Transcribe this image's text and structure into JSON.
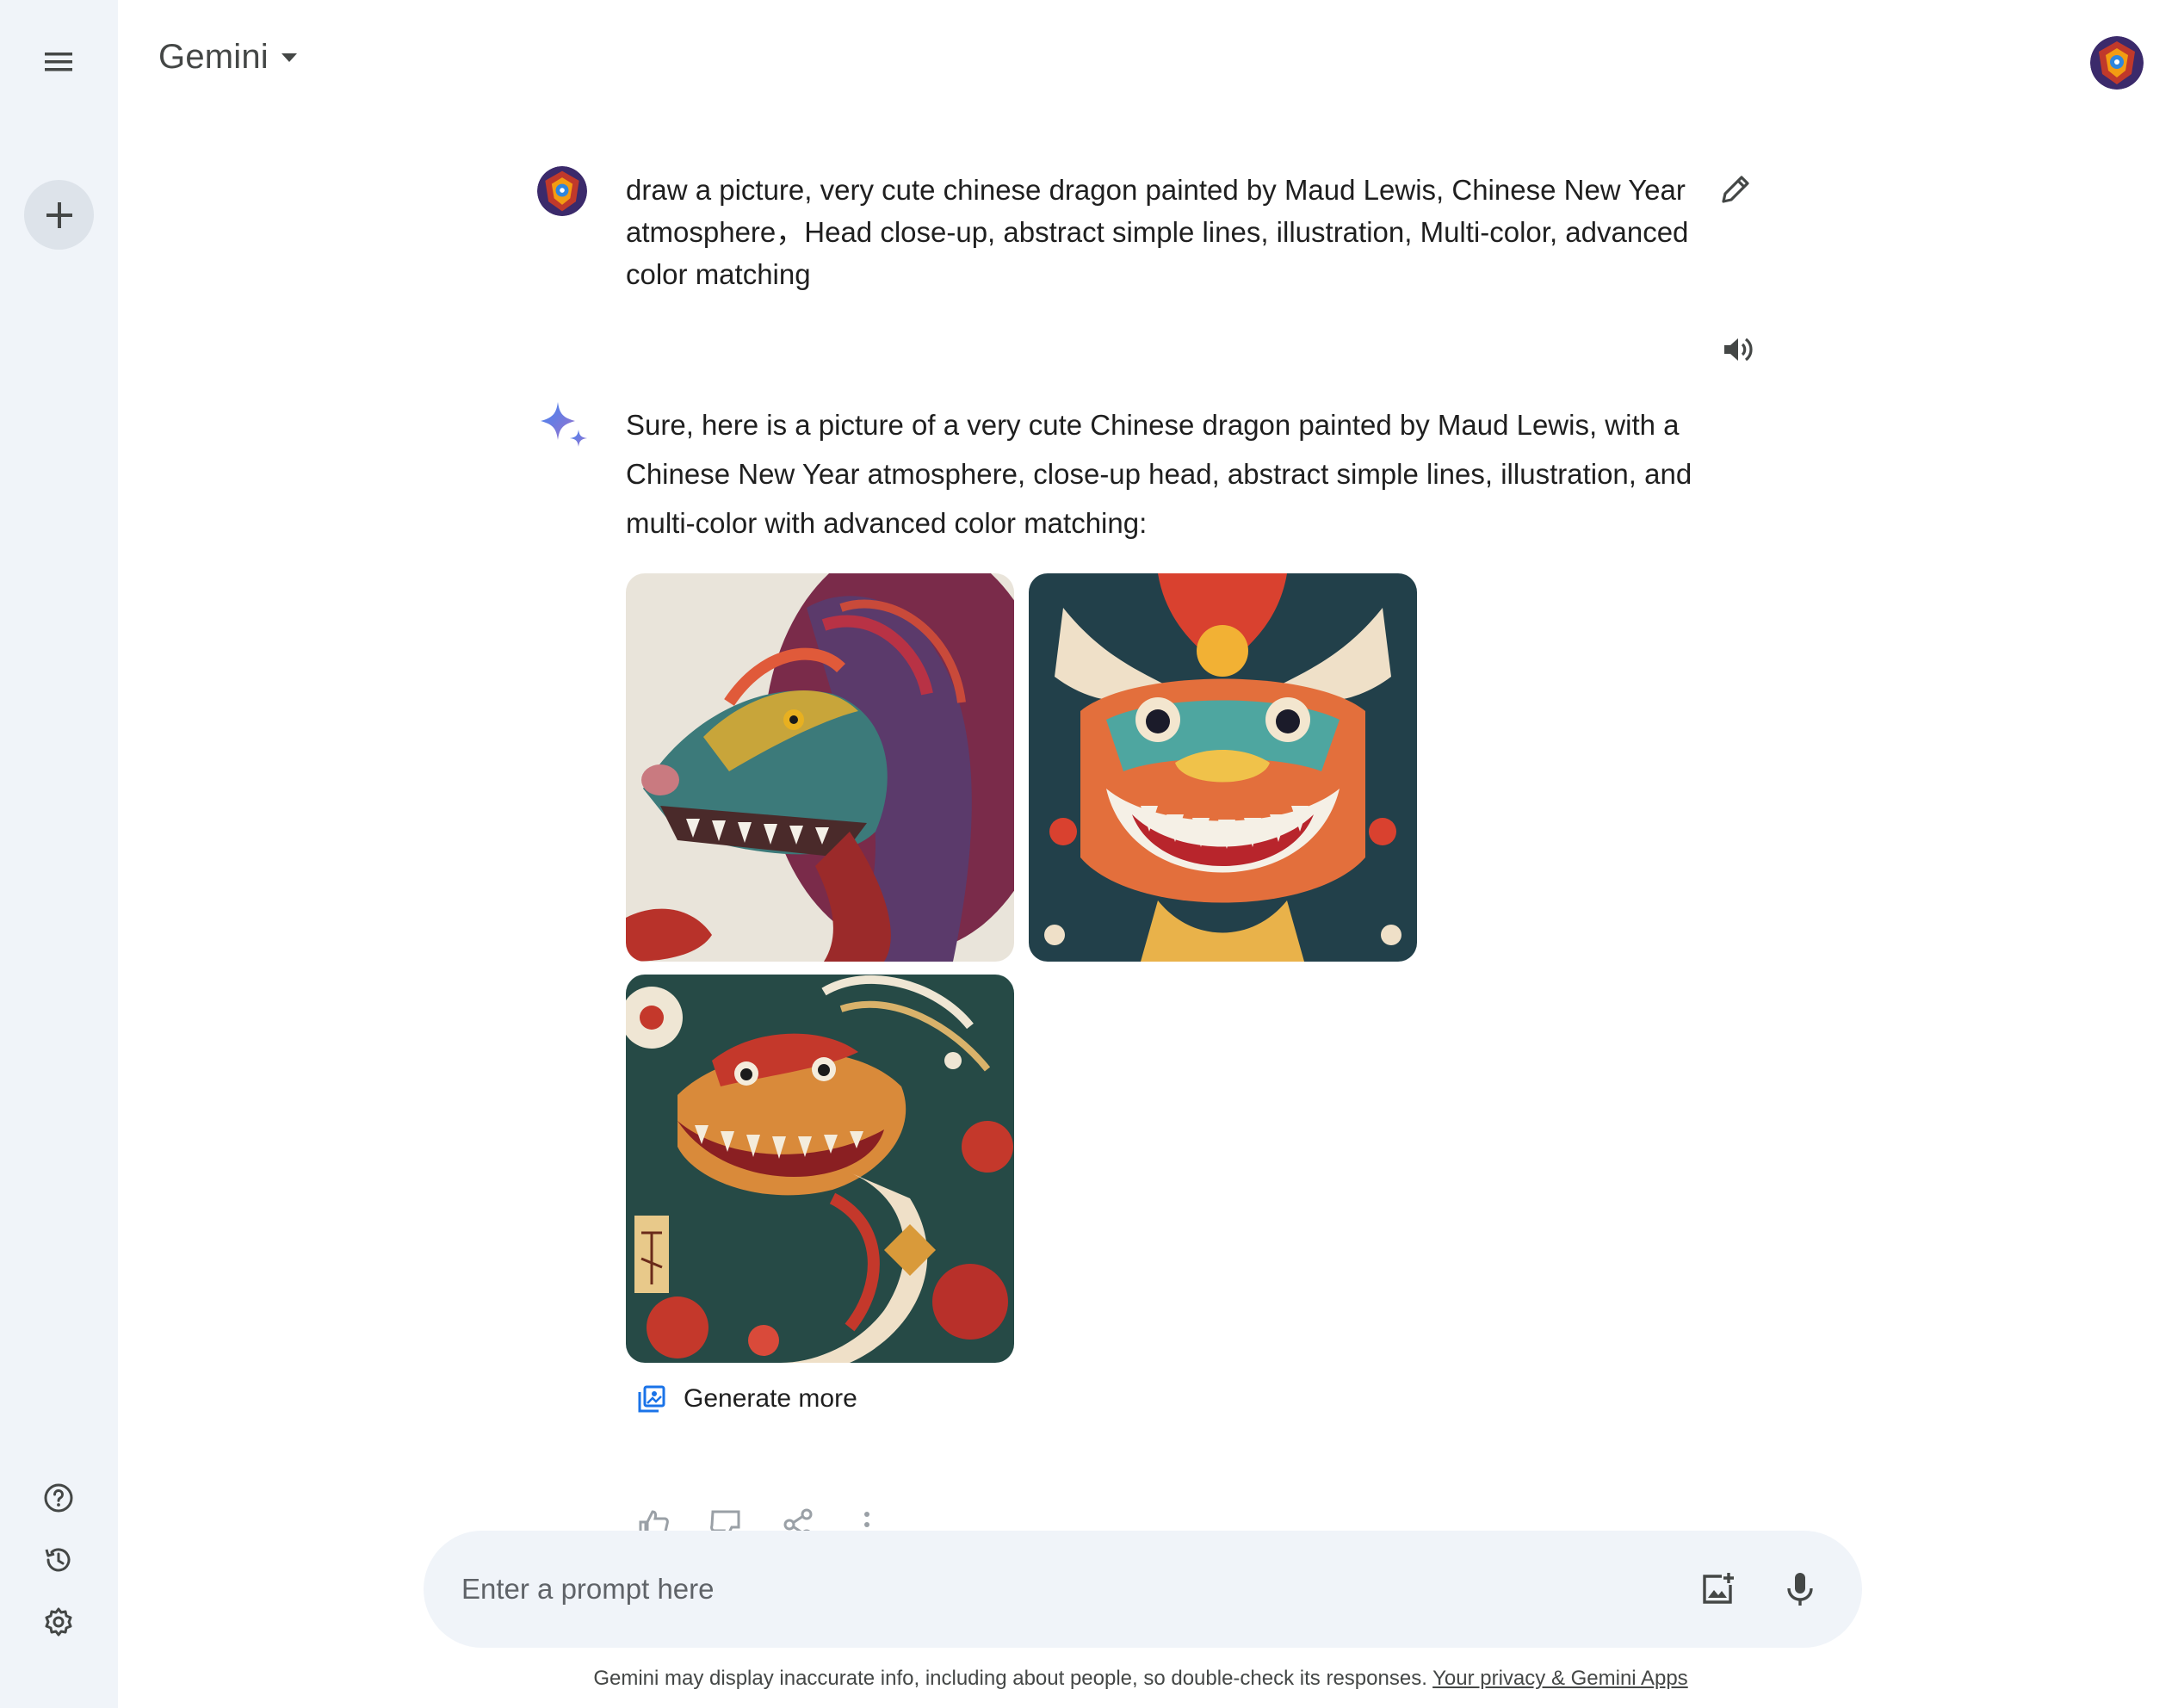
{
  "app": {
    "brand": "Gemini"
  },
  "conversation": {
    "user_query": "draw a picture, very cute chinese dragon painted by Maud Lewis, Chinese New Year atmosphere，Head close-up, abstract simple lines, illustration, Multi-color, advanced color matching",
    "response_text": "Sure, here is a picture of a very cute Chinese dragon painted by Maud Lewis, with a Chinese New Year atmosphere, close-up head, abstract simple lines, illustration, and multi-color with advanced color matching:",
    "generate_more_label": "Generate more"
  },
  "input": {
    "placeholder": "Enter a prompt here"
  },
  "footer": {
    "disclaimer": "Gemini may display inaccurate info, including about people, so double-check its responses.",
    "privacy_link": "Your privacy & Gemini Apps"
  },
  "icons": {
    "menu": "menu-icon",
    "new_chat": "plus-icon",
    "help": "help-icon",
    "activity": "history-icon",
    "settings": "gear-icon",
    "dropdown": "caret-down-icon",
    "edit": "pencil-icon",
    "speaker": "speaker-icon",
    "sparkle": "sparkle-icon",
    "generate_more": "image-stack-icon",
    "upload_image": "add-image-icon",
    "mic": "microphone-icon"
  },
  "colors": {
    "rail_bg": "#f0f4f9",
    "input_bg": "#f0f4f9",
    "text": "#1f1f1f",
    "muted": "#444746",
    "accent": "#1a73e8"
  }
}
